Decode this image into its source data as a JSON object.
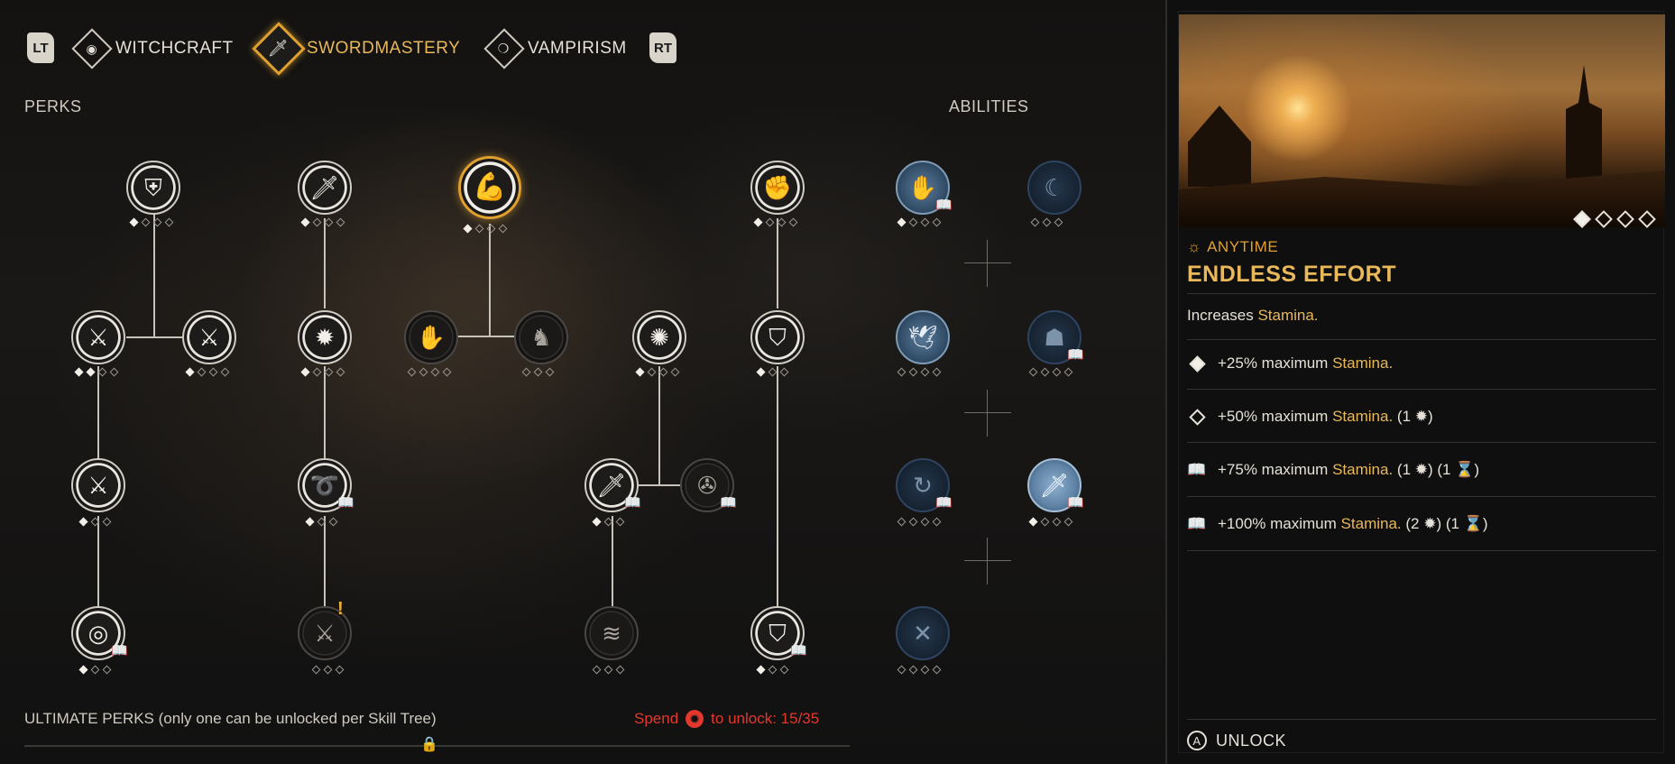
{
  "tabs": {
    "lt": "LT",
    "rt": "RT",
    "witchcraft": "WITCHCRAFT",
    "swordmastery": "SWORDMASTERY",
    "vampirism": "VAMPIRISM"
  },
  "sections": {
    "perks": "PERKS",
    "abilities": "ABILITIES"
  },
  "book_glyph": "📖",
  "alert_glyph": "!",
  "nodes": [
    {
      "icon": "shield-icon",
      "glyph": "⛨",
      "style": "lit",
      "pips": [
        1,
        0,
        0,
        0
      ]
    },
    {
      "icon": "dagger-icon",
      "glyph": "🗡",
      "style": "lit",
      "pips": [
        1,
        0,
        0,
        0
      ]
    },
    {
      "icon": "flexed-arm-icon",
      "glyph": "💪",
      "style": "selected",
      "pips": [
        1,
        0,
        0,
        0
      ]
    },
    {
      "icon": "fist-icon",
      "glyph": "✊",
      "style": "lit",
      "pips": [
        1,
        0,
        0,
        0
      ]
    },
    {
      "icon": "bleeding-blade-icon",
      "glyph": "⚔",
      "style": "lit",
      "pips": [
        1,
        1,
        0,
        0
      ]
    },
    {
      "icon": "crossed-swords-icon",
      "glyph": "⚔",
      "style": "lit",
      "pips": [
        1,
        0,
        0,
        0
      ]
    },
    {
      "icon": "burst-icon",
      "glyph": "✹",
      "style": "lit",
      "pips": [
        1,
        0,
        0,
        0
      ]
    },
    {
      "icon": "claw-hand-icon",
      "glyph": "✋",
      "style": "dark",
      "pips": [
        0,
        0,
        0,
        0
      ]
    },
    {
      "icon": "beast-icon",
      "glyph": "♞",
      "style": "dark",
      "pips": [
        0,
        0,
        0
      ]
    },
    {
      "icon": "flame-star-icon",
      "glyph": "✺",
      "style": "lit",
      "pips": [
        1,
        0,
        0,
        0
      ]
    },
    {
      "icon": "armor-icon",
      "glyph": "⛉",
      "style": "lit",
      "pips": [
        1,
        0,
        0
      ]
    },
    {
      "icon": "slash-icon",
      "glyph": "⚔",
      "style": "lit",
      "pips": [
        1,
        0,
        0
      ]
    },
    {
      "icon": "whip-icon",
      "glyph": "➰",
      "style": "lit",
      "pips": [
        1,
        0,
        0
      ]
    },
    {
      "icon": "sword-down-icon",
      "glyph": "🗡",
      "style": "lit",
      "pips": [
        1,
        0,
        0
      ]
    },
    {
      "icon": "wheel-icon",
      "glyph": "✇",
      "style": "dark",
      "pips": []
    },
    {
      "icon": "target-icon",
      "glyph": "◎",
      "style": "lit",
      "pips": [
        1,
        0,
        0
      ]
    },
    {
      "icon": "stuck-swords-icon",
      "glyph": "⚔",
      "style": "dark",
      "pips": [
        0,
        0,
        0
      ]
    },
    {
      "icon": "wind-slash-icon",
      "glyph": "≋",
      "style": "dark",
      "pips": [
        0,
        0,
        0
      ]
    },
    {
      "icon": "plate-armor-icon",
      "glyph": "⛉",
      "style": "lit",
      "pips": [
        1,
        0,
        0
      ]
    }
  ],
  "abilities": [
    {
      "icon": "shatter-hand-icon",
      "glyph": "✋",
      "style": "blue",
      "pips": [
        1,
        0,
        0,
        0
      ]
    },
    {
      "icon": "sickle-strike-icon",
      "glyph": "☾",
      "style": "blue-dark",
      "pips": [
        0,
        0,
        0
      ]
    },
    {
      "icon": "bird-strike-icon",
      "glyph": "🕊",
      "style": "blue",
      "pips": [
        0,
        0,
        0,
        0
      ]
    },
    {
      "icon": "rune-head-icon",
      "glyph": "☗",
      "style": "blue-dark",
      "pips": [
        0,
        0,
        0,
        0
      ]
    },
    {
      "icon": "vortex-icon",
      "glyph": "↻",
      "style": "blue-dark",
      "pips": [
        0,
        0,
        0,
        0
      ]
    },
    {
      "icon": "serpent-sword-icon",
      "glyph": "🗡",
      "style": "blue-light",
      "pips": [
        1,
        0,
        0,
        0
      ]
    },
    {
      "icon": "cross-bolt-icon",
      "glyph": "✕",
      "style": "blue-dark",
      "pips": [
        0,
        0,
        0,
        0
      ]
    }
  ],
  "footer": {
    "ultimate_text": "ULTIMATE PERKS (only one can be unlocked per Skill Tree)",
    "spend_label": "Spend",
    "unlock_label": "to unlock: 15/35",
    "progress_fraction": 0.4286
  },
  "detail": {
    "timing": "ANYTIME",
    "title": "ENDLESS EFFORT",
    "description_prefix": "Increases",
    "description_keyword": "Stamina.",
    "pager_count": 4,
    "pager_selected": 0,
    "tiers": [
      {
        "icon": "filled-diamond-icon",
        "prefix": "+25% maximum",
        "keyword": "Stamina.",
        "cost": ""
      },
      {
        "icon": "empty-diamond-icon",
        "prefix": "+50% maximum",
        "keyword": "Stamina.",
        "cost": "(1 ✹)"
      },
      {
        "icon": "book-icon",
        "prefix": "+75% maximum",
        "keyword": "Stamina.",
        "cost": "(1 ✹) (1 ⌛)"
      },
      {
        "icon": "book-icon",
        "prefix": "+100% maximum",
        "keyword": "Stamina.",
        "cost": "(2 ✹) (1 ⌛)"
      }
    ],
    "unlock_button": "A",
    "unlock_label": "UNLOCK"
  },
  "colors": {
    "accent_gold": "#e8b85a",
    "selection_orange": "#e0a030",
    "warning_red": "#e3382e",
    "ability_blue": "#5a7a99"
  }
}
